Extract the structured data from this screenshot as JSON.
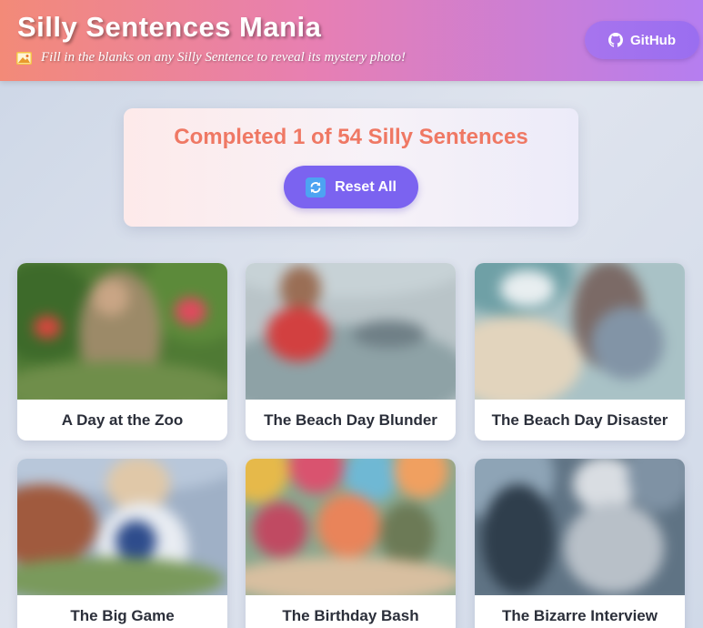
{
  "header": {
    "title": "Silly Sentences Mania",
    "subtitle": "Fill in the blanks on any Silly Sentence to reveal its mystery photo!",
    "subtitle_icon": "photo-icon",
    "github_label": "GitHub",
    "github_icon": "github-icon"
  },
  "progress": {
    "text": "Completed 1 of 54 Silly Sentences",
    "completed": 1,
    "total": 54,
    "reset_label": "Reset All",
    "reset_icon": "refresh-icon"
  },
  "colors": {
    "header_gradient_start": "#f38a78",
    "header_gradient_end": "#b57ef0",
    "progress_text": "#ef7864",
    "reset_button": "#7b63f0",
    "card_title": "#2b2f3a"
  },
  "cards": [
    {
      "title": "A Day at the Zoo"
    },
    {
      "title": "The Beach Day Blunder"
    },
    {
      "title": "The Beach Day Disaster"
    },
    {
      "title": "The Big Game"
    },
    {
      "title": "The Birthday Bash"
    },
    {
      "title": "The Bizarre Interview"
    }
  ]
}
